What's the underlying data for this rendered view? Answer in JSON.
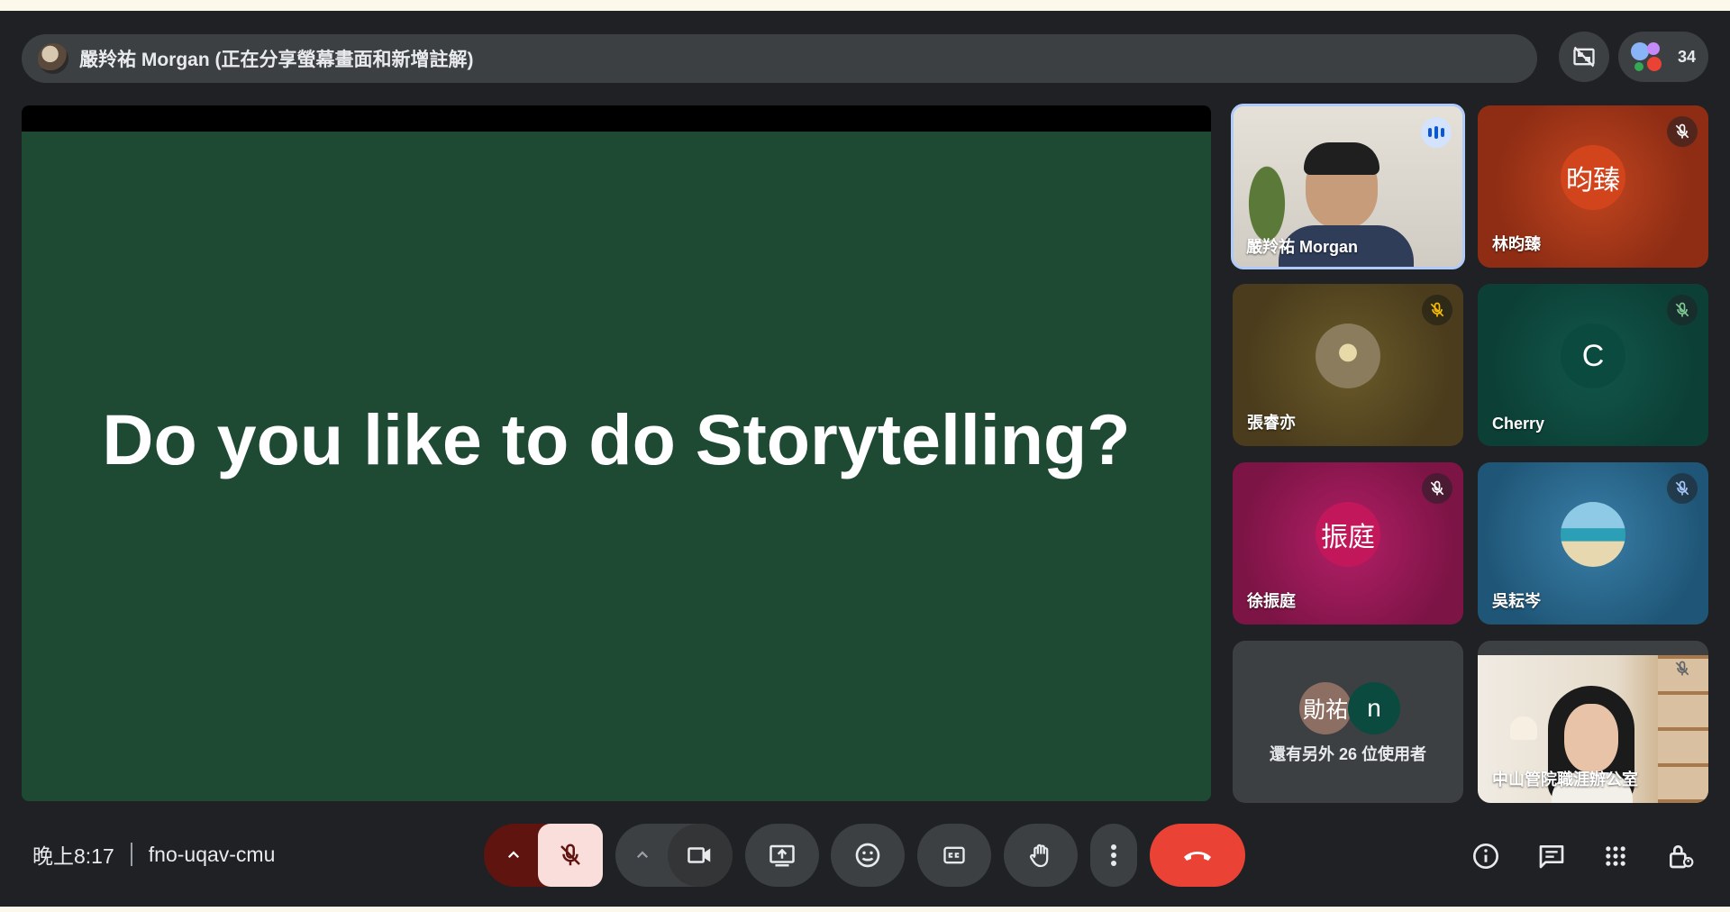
{
  "presenter_banner": {
    "text": "嚴羚祐 Morgan (正在分享螢幕畫面和新增註解)"
  },
  "top_right": {
    "people_count": "34",
    "hide_tiles_icon": "tiles-off-icon"
  },
  "slide": {
    "text": "Do you like to do Storytelling?"
  },
  "tiles": [
    {
      "name": "嚴羚祐 Morgan",
      "initials": "",
      "status": "speaking"
    },
    {
      "name": "林昀臻",
      "initials": "昀臻",
      "status": "muted"
    },
    {
      "name": "張睿亦",
      "initials": "",
      "status": "muted"
    },
    {
      "name": "Cherry",
      "initials": "C",
      "status": "muted"
    },
    {
      "name": "徐振庭",
      "initials": "振庭",
      "status": "muted"
    },
    {
      "name": "吳耘岑",
      "initials": "",
      "status": "muted"
    },
    {
      "name": "",
      "initials": "",
      "status": "others"
    },
    {
      "name": "中山管院職涯辦公室",
      "initials": "",
      "status": "muted"
    }
  ],
  "others_tile": {
    "avatar1": "勛祐",
    "avatar2": "n",
    "label": "還有另外 26 位使用者"
  },
  "bottom_bar": {
    "time": "晚上8:17",
    "meeting_code": "fno-uqav-cmu"
  },
  "colors": {
    "slide_bg": "#1e4a34",
    "end_call": "#ea4335",
    "mic_off_bg": "#f9dedc",
    "mic_options_bg": "#601410"
  }
}
